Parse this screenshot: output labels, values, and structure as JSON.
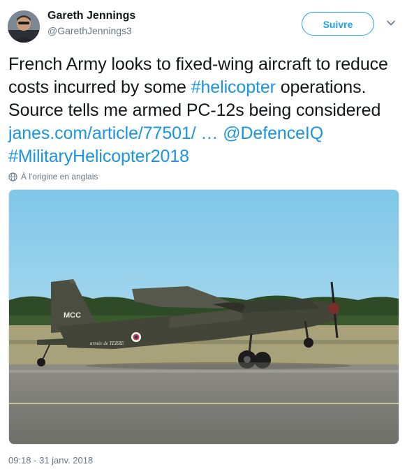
{
  "author": {
    "name": "Gareth Jennings",
    "handle": "@GarethJennings3",
    "avatar_icon": "profile-photo"
  },
  "follow_button": {
    "label": "Suivre"
  },
  "menu": {
    "icon": "chevron-down-icon"
  },
  "tweet": {
    "text_1": "French Army looks to fixed-wing aircraft to reduce costs incurred by some ",
    "hashtag_1": "#helicopter",
    "text_2": " operations. Source tells me armed PC-12s being considered ",
    "link": "janes.com/article/77501/ …",
    "space_1": " ",
    "mention": "@DefenceIQ",
    "space_2": " ",
    "hashtag_2": "#MilitaryHelicopter2018"
  },
  "translation": {
    "label": "À l'origine en anglais",
    "icon": "globe-icon"
  },
  "media": {
    "description_icon": "aircraft-photo",
    "tail_code": "MCC",
    "fuselage_text": "armée de TERRE"
  },
  "timestamp": "09:18 - 31 janv. 2018",
  "colors": {
    "link": "#1b95e0",
    "accent": "#1da1f2",
    "secondary_text": "#657786"
  }
}
